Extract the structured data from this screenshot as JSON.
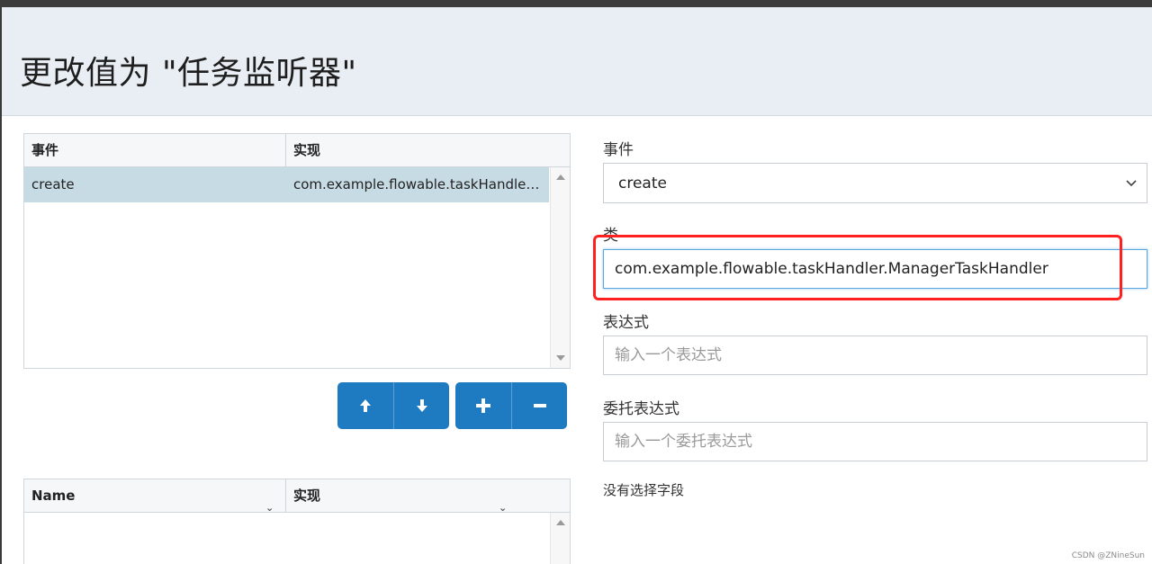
{
  "modal": {
    "title": "更改值为 \"任务监听器\""
  },
  "listeners_grid": {
    "columns": [
      "事件",
      "实现"
    ],
    "rows": [
      {
        "event": "create",
        "implementation": "com.example.flowable.taskHandler.ManagerTaskHandler"
      }
    ]
  },
  "buttons": {
    "move_up_icon": "arrow-up-icon",
    "move_down_icon": "arrow-down-icon",
    "add_icon": "plus-icon",
    "remove_icon": "minus-icon",
    "color": "#1f7bc1"
  },
  "fields_grid": {
    "columns": [
      "Name",
      "实现"
    ]
  },
  "form": {
    "event_label": "事件",
    "event_value": "create",
    "class_label": "类",
    "class_value": "com.example.flowable.taskHandler.ManagerTaskHandler",
    "expression_label": "表达式",
    "expression_placeholder": "输入一个表达式",
    "delegate_label": "委托表达式",
    "delegate_placeholder": "输入一个委托表达式",
    "no_field_text": "没有选择字段"
  },
  "highlight_color": "#ff2020",
  "watermark": "CSDN @ZNineSun"
}
